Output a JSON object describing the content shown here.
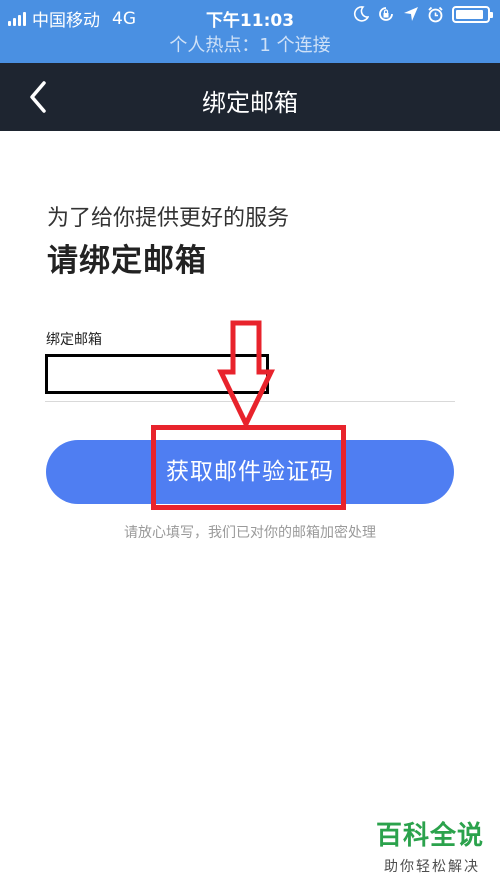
{
  "status_bar": {
    "carrier": "中国移动",
    "network": "4G",
    "time": "下午11:03",
    "battery_level": 0.9,
    "icons": [
      "signal-icon",
      "moon-icon",
      "rotation-lock-icon",
      "location-icon",
      "alarm-icon",
      "battery-icon"
    ]
  },
  "hotspot_banner": "个人热点：1 个连接",
  "nav": {
    "title": "绑定邮箱",
    "back_icon": "chevron-left-icon"
  },
  "form": {
    "intro": "为了给你提供更好的服务",
    "headline": "请绑定邮箱",
    "email_label": "绑定邮箱",
    "email_value": "",
    "submit_label": "获取邮件验证码",
    "privacy_hint": "请放心填写，我们已对你的邮箱加密处理"
  },
  "watermark": {
    "title": "百科全说",
    "subtitle": "助你轻松解决"
  },
  "colors": {
    "status_bar": "#4a90e2",
    "nav_bar": "#1e2530",
    "primary_button": "#4f7ef2",
    "annotation": "#e8232c",
    "watermark": "#2ba24c"
  }
}
